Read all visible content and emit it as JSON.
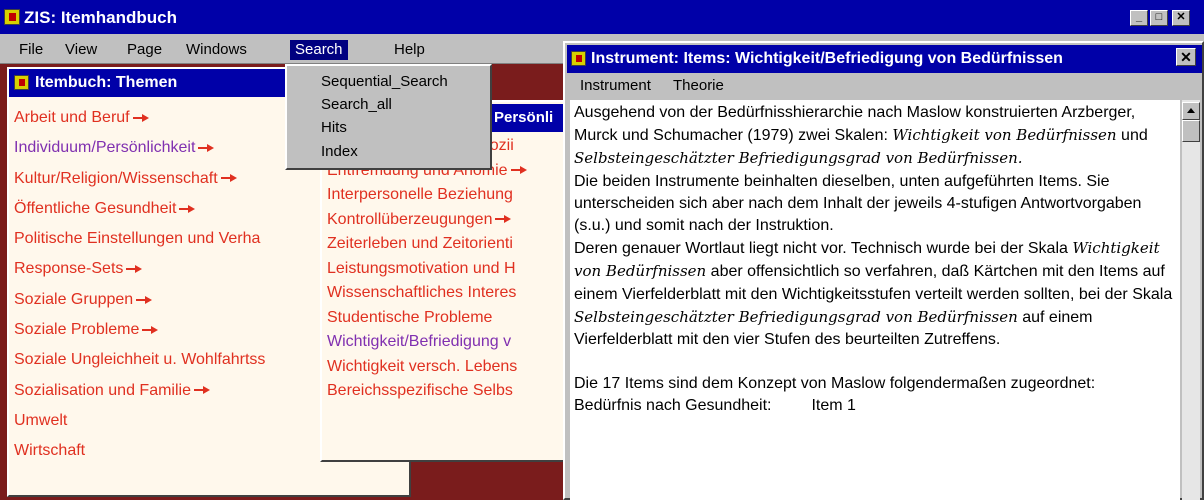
{
  "app": {
    "title": "ZIS: Itemhandbuch"
  },
  "menu": {
    "file": "File",
    "view": "View",
    "page": "Page",
    "windows": "Windows",
    "search": "Search",
    "help": "Help"
  },
  "search_menu": {
    "items": [
      "Sequential_Search",
      "Search_all",
      "Hits",
      "Index"
    ]
  },
  "left_window": {
    "title": "Itembuch: Themen",
    "topics": [
      "Arbeit und Beruf",
      "Individuum/Persönlichkeit",
      "Kultur/Religion/Wissenschaft",
      "Öffentliche Gesundheit",
      "Politische Einstellungen und Verha",
      "Response-Sets",
      "Soziale Gruppen",
      "Soziale Probleme",
      "Soziale Ungleichheit u. Wohlfahrtss",
      "Sozialisation und Familie",
      "Umwelt",
      "Wirtschaft"
    ]
  },
  "mid_window": {
    "title": "Persönli",
    "items": [
      "Autoritarismus und assozii",
      "Entfremdung und Anomie",
      "Interpersonelle Beziehung",
      "Kontrollüberzeugungen",
      "Zeiterleben und Zeitorienti",
      "Leistungsmotivation und H",
      "Wissenschaftliches Interes",
      "Studentische Probleme",
      "Wichtigkeit/Befriedigung v",
      "Wichtigkeit versch. Lebens",
      "Bereichsspezifische Selbs"
    ]
  },
  "right_window": {
    "title": "Instrument: Items: Wichtigkeit/Befriedigung von Bedürfnissen",
    "menu": {
      "instrument": "Instrument",
      "theorie": "Theorie"
    },
    "para1_a": "Ausgehend von der Bedürfnisshierarchie nach Maslow konstruierten Arzberger, Murck und Schumacher (1979)  zwei Skalen: ",
    "para1_i1": "Wichtigkeit von Bedürfnissen",
    "para1_b": " und ",
    "para1_i2": "Selbsteingeschätzter Befriedigungsgrad von Bedürfnissen.",
    "para2": "Die beiden Instrumente beinhalten dieselben, unten aufgeführten Items.  Sie unterscheiden sich aber nach dem Inhalt der jeweils 4-stufigen Antwortvorgaben (s.u.) und somit nach der Instruktion.",
    "para3_a": "Deren genauer Wortlaut liegt nicht vor. Technisch wurde bei der Skala ",
    "para3_i1": "Wichtigkeit von Bedürfnissen",
    "para3_b": " aber offensichtlich so verfahren, daß Kärtchen mit den Items auf einem Vierfelderblatt mit den Wichtigkeitsstufen verteilt werden sollten, bei der Skala ",
    "para3_i2": "Selbsteingeschätzter Befriedigungsgrad von Bedürfnissen",
    "para3_c": " auf einem Vierfelderblatt mit den vier Stufen des beurteilten Zutreffens.",
    "para4": "Die 17 Items sind dem Konzept von Maslow folgendermaßen zugeordnet:",
    "row1_label": "Bedürfnis nach Gesundheit:",
    "row1_value": "Item 1"
  }
}
